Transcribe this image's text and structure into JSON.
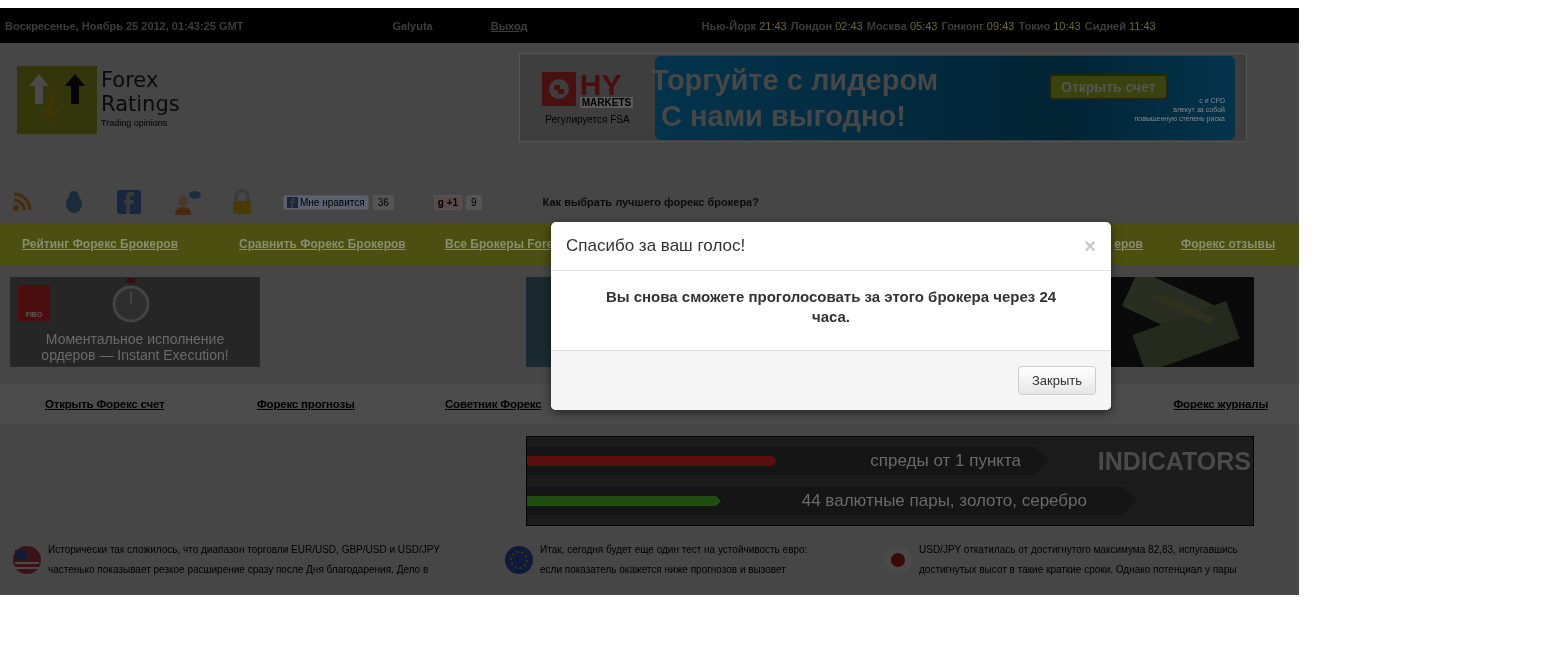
{
  "top_bar": {
    "date": "Воскресенье, Ноябрь 25 2012, 01:43:25 GMT",
    "user": "Galyuta",
    "logout": "Выход",
    "clocks": [
      {
        "city": "Нью-Йорк",
        "time": "21:43"
      },
      {
        "city": "Лондон",
        "time": "02:43"
      },
      {
        "city": "Москва",
        "time": "05:43"
      },
      {
        "city": "Гонконг",
        "time": "09:43"
      },
      {
        "city": "Токио",
        "time": "10:43"
      },
      {
        "city": "Сидней",
        "time": "11:43"
      }
    ]
  },
  "logo": {
    "title_lines": [
      "Forex",
      "Ratings"
    ],
    "tagline": "Trading opinions"
  },
  "ad_banner": {
    "brand": "HY",
    "brand_sub": "MARKETS",
    "regulated": "Регулируется FSA",
    "headlines": [
      "Торгуйте с лидером",
      "С нами выгодно!"
    ],
    "button": "Открыть счет",
    "disclaimer": [
      "с и CFD",
      "влекут за собой",
      "повышенную степень риска"
    ]
  },
  "social": {
    "like": {
      "label": "Мне нравится",
      "count": "36"
    },
    "plus_one": {
      "label": "g +1",
      "count": "9"
    },
    "guide_link": "Как выбрать лучшего форекс брокера?"
  },
  "nav": {
    "items": [
      {
        "label": "Рейтинг Форекс Брокеров"
      },
      {
        "label": "Сравнить Форекс Брокеров"
      },
      {
        "label": "Все Брокеры Fore"
      },
      {
        "label": "еров"
      },
      {
        "label": "Форекс отзывы"
      }
    ]
  },
  "promo_left": {
    "badge": "FIBO",
    "text": "Моментальное исполнение ордеров — Instant Execution!"
  },
  "links": [
    {
      "label": "Открыть Форекс счет"
    },
    {
      "label": "Форекс прогнозы"
    },
    {
      "label": "Советник Форекс"
    },
    {
      "label": "Форекс журналы"
    }
  ],
  "feature_banner": {
    "bars": [
      {
        "label": "спреды от 1 пункта",
        "color": "#5c0f0f"
      },
      {
        "label": "44 валютные пары, золото, серебро",
        "color": "#1f4d12"
      }
    ],
    "watermark": "INDICATORS"
  },
  "news": [
    {
      "kind": "usa",
      "lines": [
        "Исторически так сложилось, что диапазон торговли EUR/USD, GBP/USD и USD/JPY",
        "частенько показывает резкое расширение сразу после Дня благодарения. Дело в"
      ]
    },
    {
      "kind": "eu",
      "lines": [
        "Итак, сегодня будет еще один тест на устойчивость евро:",
        "если показатель окажется ниже прогнозов и вызовет"
      ]
    },
    {
      "kind": "japan",
      "lines": [
        "USD/JPY откатилась от достигнутого максимума 82,83, испугавшись",
        "достигнутых высот в такие краткие сроки. Однако потенциал у пары"
      ]
    }
  ],
  "modal": {
    "title": "Спасибо за ваш голос!",
    "close_icon": "×",
    "message": "Вы снова сможете проголосовать за этого брокера через 24 часа.",
    "button": "Закрыть"
  }
}
